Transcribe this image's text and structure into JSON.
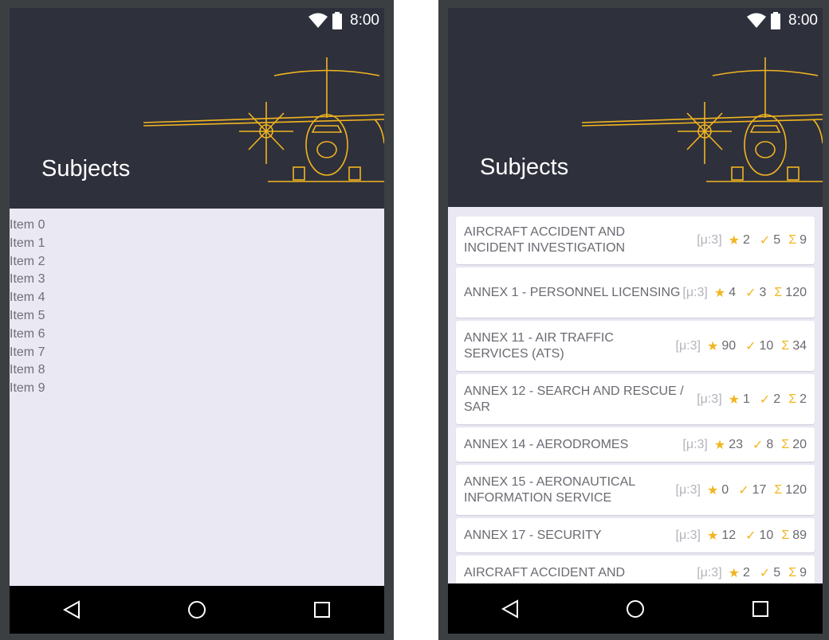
{
  "left_screen": {
    "status": {
      "time": "8:00"
    },
    "title": "Subjects",
    "items": [
      "Item 0",
      "Item 1",
      "Item 2",
      "Item 3",
      "Item 4",
      "Item 5",
      "Item 6",
      "Item 7",
      "Item 8",
      "Item 9"
    ]
  },
  "right_screen": {
    "status": {
      "time": "8:00"
    },
    "title": "Subjects",
    "subjects": [
      {
        "name": "AIRCRAFT ACCIDENT AND INCIDENT INVESTIGATION",
        "mu": "[μ:3]",
        "stars": "2",
        "checks": "5",
        "total": "9"
      },
      {
        "name": "ANNEX 1 - PERSONNEL LICENSING",
        "mu": "[μ:3]",
        "stars": "4",
        "checks": "3",
        "total": "120"
      },
      {
        "name": "ANNEX 11 - AIR TRAFFIC SERVICES (ATS)",
        "mu": "[μ:3]",
        "stars": "90",
        "checks": "10",
        "total": "34"
      },
      {
        "name": "ANNEX 12 - SEARCH AND RESCUE / SAR",
        "mu": "[μ:3]",
        "stars": "1",
        "checks": "2",
        "total": "2"
      },
      {
        "name": "ANNEX 14 - AERODROMES",
        "mu": "[μ:3]",
        "stars": "23",
        "checks": "8",
        "total": "20"
      },
      {
        "name": "ANNEX 15 - AERONAUTICAL INFORMATION SERVICE",
        "mu": "[μ:3]",
        "stars": "0",
        "checks": "17",
        "total": "120"
      },
      {
        "name": "ANNEX 17 - SECURITY",
        "mu": "[μ:3]",
        "stars": "12",
        "checks": "10",
        "total": "89"
      },
      {
        "name": "AIRCRAFT ACCIDENT AND",
        "mu": "[μ:3]",
        "stars": "2",
        "checks": "5",
        "total": "9"
      }
    ]
  },
  "colors": {
    "appbar": "#2e303c",
    "accent": "#f2b51f",
    "background": "#e9e8f3"
  },
  "icons": {
    "wifi": "wifi-icon",
    "battery": "battery-icon",
    "back": "back-icon",
    "home": "home-icon",
    "recents": "recents-icon",
    "star": "star-icon",
    "check": "check-icon",
    "sigma": "sigma-icon"
  }
}
